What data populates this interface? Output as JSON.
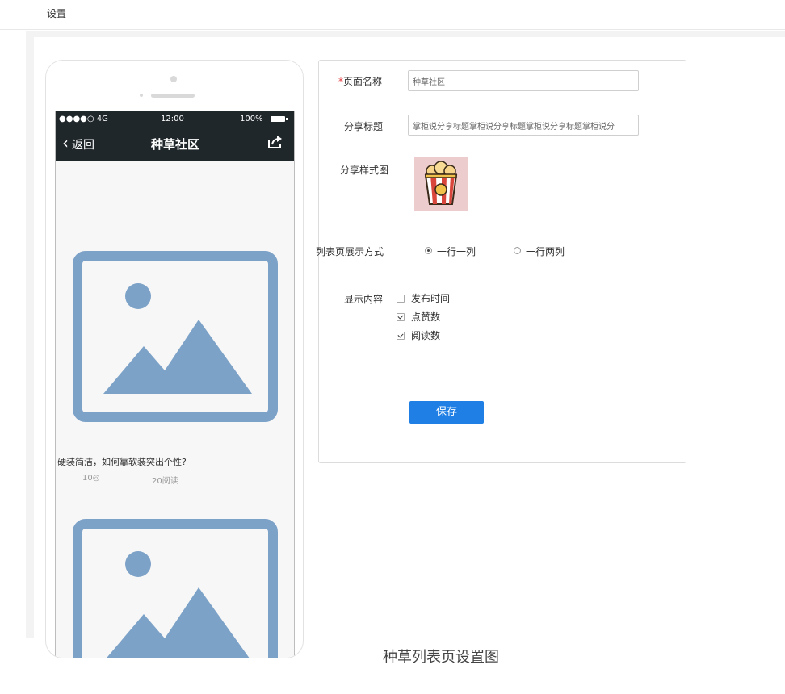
{
  "header": {
    "title": "设置"
  },
  "phone": {
    "status": {
      "carrier": "●●●●○ 4G",
      "time": "12:00",
      "battery": "100%"
    },
    "nav": {
      "back_label": "返回",
      "title": "种草社区"
    },
    "article": {
      "title": "硬装简洁，如何靠软装突出个性?",
      "likes": "10◎",
      "reads": "20阅读"
    }
  },
  "form": {
    "page_name": {
      "label": "页面名称",
      "required_mark": "*",
      "value": "种草社区"
    },
    "share_title": {
      "label": "分享标题",
      "value": "掌柜说分享标题掌柜说分享标题掌柜说分享标题掌柜说分"
    },
    "share_image": {
      "label": "分享样式图"
    },
    "list_mode": {
      "label": "列表页展示方式",
      "options": [
        {
          "label": "一行一列",
          "selected": true
        },
        {
          "label": "一行两列",
          "selected": false
        }
      ]
    },
    "display": {
      "label": "显示内容",
      "options": [
        {
          "label": "发布时间",
          "checked": false
        },
        {
          "label": "点赞数",
          "checked": true
        },
        {
          "label": "阅读数",
          "checked": true
        }
      ]
    },
    "save_label": "保存"
  },
  "caption": "种草列表页设置图",
  "colors": {
    "primary": "#1f7fe5",
    "navbar": "#20272b",
    "placeholder_image": "#7da2c8",
    "required": "#e4393c"
  }
}
